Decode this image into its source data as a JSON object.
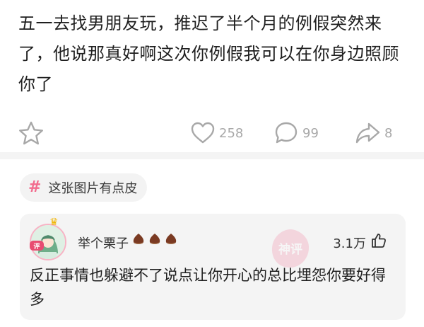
{
  "post": {
    "text": "五一去找男朋友玩，推迟了半个月的例假突然来了，他说那真好啊这次你例假我可以在你身边照顾你了"
  },
  "actions": {
    "favorite_icon": "star-icon",
    "like_count": "258",
    "comment_count": "99",
    "share_count": "8"
  },
  "tag": {
    "hash": "#",
    "label": "这张图片有点皮"
  },
  "comment": {
    "user_name": "举个栗子",
    "badge_count_icons": [
      "chestnut-icon",
      "chestnut-icon",
      "chestnut-icon"
    ],
    "likes": "3.1万",
    "text": "反正事情也躲避不了说点让你开心的总比埋怨你要好得多",
    "stamp_text": "神评",
    "avatar_badge_text": "评"
  },
  "colors": {
    "accent_pink": "#f26c8e",
    "icon_gray": "#a8a8a8",
    "chestnut": "#7a3a22"
  }
}
